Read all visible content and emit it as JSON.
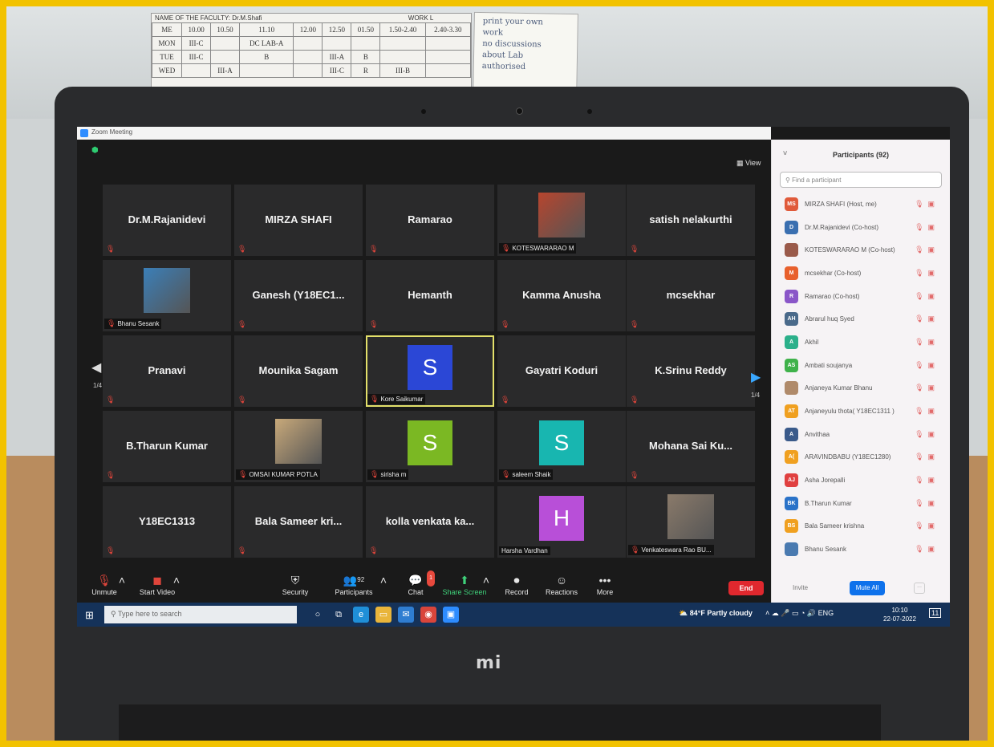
{
  "timetable": {
    "faculty_label": "NAME OF THE FACULTY:",
    "faculty_name": "Dr.M.Shafi",
    "workload_label": "WORK L",
    "header": [
      "ME",
      "10.00",
      "10.50",
      "11.10",
      "12.00",
      "12.50",
      "01.50",
      "1.50-2.40",
      "2.40-3.30"
    ],
    "rows": [
      [
        "MON",
        "III-C",
        "",
        "DC LAB-A",
        "",
        "",
        "",
        "",
        ""
      ],
      [
        "TUE",
        "III-C",
        "",
        "B",
        "",
        "III-A",
        "B",
        "",
        ""
      ],
      [
        "WED",
        "",
        "III-A",
        "",
        "",
        "III-C",
        "R",
        "III-B",
        ""
      ]
    ]
  },
  "sticky_note": "print your own\nwork\nno discussions\nabout Lab\nauthorised",
  "brand": "mi",
  "zoom": {
    "window_title": "Zoom Meeting",
    "view_label": "View",
    "page_indicator_left": "1/4",
    "page_indicator_right": "1/4",
    "tiles": [
      {
        "name": "Dr.M.Rajanidevi",
        "type": "name"
      },
      {
        "name": "MIRZA SHAFI",
        "type": "name"
      },
      {
        "name": "Ramarao",
        "type": "name"
      },
      {
        "label": "KOTESWARARAO M",
        "type": "photo",
        "color": "#b7452e"
      },
      {
        "name": "satish nelakurthi",
        "type": "name"
      },
      {
        "label": "Bhanu Sesank",
        "type": "photo",
        "color": "#3b7fb8"
      },
      {
        "name": "Ganesh  (Y18EC1...",
        "type": "name"
      },
      {
        "name": "Hemanth",
        "type": "name"
      },
      {
        "name": "Kamma Anusha",
        "type": "name"
      },
      {
        "name": "mcsekhar",
        "type": "name"
      },
      {
        "name": "Pranavi",
        "type": "name"
      },
      {
        "name": "Mounika Sagam",
        "type": "name"
      },
      {
        "label": "Kore Saikumar",
        "type": "avatar",
        "letter": "S",
        "color": "#2b47d6",
        "active": true
      },
      {
        "name": "Gayatri Koduri",
        "type": "name"
      },
      {
        "name": "K.Srinu Reddy",
        "type": "name"
      },
      {
        "name": "B.Tharun Kumar",
        "type": "name"
      },
      {
        "label": "OMSAI KUMAR POTLA",
        "type": "photo",
        "color": "#c8a97a"
      },
      {
        "label": "sirisha m",
        "type": "avatar",
        "letter": "S",
        "color": "#7bb823"
      },
      {
        "label": "saleem Shaik",
        "type": "avatar",
        "letter": "S",
        "color": "#18b6b0"
      },
      {
        "name": "Mohana Sai Ku...",
        "type": "name"
      },
      {
        "name": "Y18EC1313",
        "type": "name"
      },
      {
        "name": "Bala Sameer kri...",
        "type": "name"
      },
      {
        "name": "kolla venkata ka...",
        "type": "name"
      },
      {
        "label": "Harsha Vardhan",
        "type": "avatar",
        "letter": "H",
        "color": "#b84fd8",
        "unmuted": true
      },
      {
        "label": "Venkateswara Rao BU...",
        "type": "photo",
        "color": "#8a7a6a"
      }
    ],
    "toolbar": {
      "unmute": "Unmute",
      "start_video": "Start Video",
      "security": "Security",
      "participants": "Participants",
      "participants_count": "92",
      "chat": "Chat",
      "chat_badge": "1",
      "share_screen": "Share Screen",
      "record": "Record",
      "reactions": "Reactions",
      "more": "More",
      "end": "End"
    },
    "panel": {
      "title": "Participants (92)",
      "search_placeholder": "Find a participant",
      "participants": [
        {
          "initials": "MS",
          "name": "MIRZA SHAFI (Host, me)",
          "color": "#e05a3a"
        },
        {
          "initials": "D",
          "name": "Dr.M.Rajanidevi (Co-host)",
          "color": "#3a6fb0"
        },
        {
          "initials": "",
          "name": "KOTESWARARAO M (Co-host)",
          "color": "#9a5a4a"
        },
        {
          "initials": "M",
          "name": "mcsekhar (Co-host)",
          "color": "#e8602c"
        },
        {
          "initials": "R",
          "name": "Ramarao (Co-host)",
          "color": "#8a56c8"
        },
        {
          "initials": "AH",
          "name": "Abrarul huq Syed",
          "color": "#4a6a8a"
        },
        {
          "initials": "A",
          "name": "Akhil",
          "color": "#2bb08a"
        },
        {
          "initials": "AS",
          "name": "Ambati soujanya",
          "color": "#3fb24a"
        },
        {
          "initials": "",
          "name": "Anjaneya Kumar Bhanu",
          "color": "#b08a6a"
        },
        {
          "initials": "AT",
          "name": "Anjaneyulu thota( Y18EC1311 )",
          "color": "#f0a020"
        },
        {
          "initials": "A",
          "name": "Anvithaa",
          "color": "#3a5a8a"
        },
        {
          "initials": "A(",
          "name": "ARAVINDBABU (Y18EC1280)",
          "color": "#f0a020"
        },
        {
          "initials": "AJ",
          "name": "Asha Jorepalli",
          "color": "#e04040"
        },
        {
          "initials": "BK",
          "name": "B.Tharun Kumar",
          "color": "#2a72c8"
        },
        {
          "initials": "BS",
          "name": "Bala Sameer krishna",
          "color": "#f0a020"
        },
        {
          "initials": "",
          "name": "Bhanu Sesank",
          "color": "#4a7ab0"
        }
      ],
      "invite": "Invite",
      "mute_all": "Mute All",
      "more": "..."
    }
  },
  "taskbar": {
    "search_placeholder": "Type here to search",
    "weather": "84°F  Partly cloudy",
    "language": "ENG",
    "time": "10:10",
    "date": "22-07-2022",
    "notification_count": "11"
  }
}
